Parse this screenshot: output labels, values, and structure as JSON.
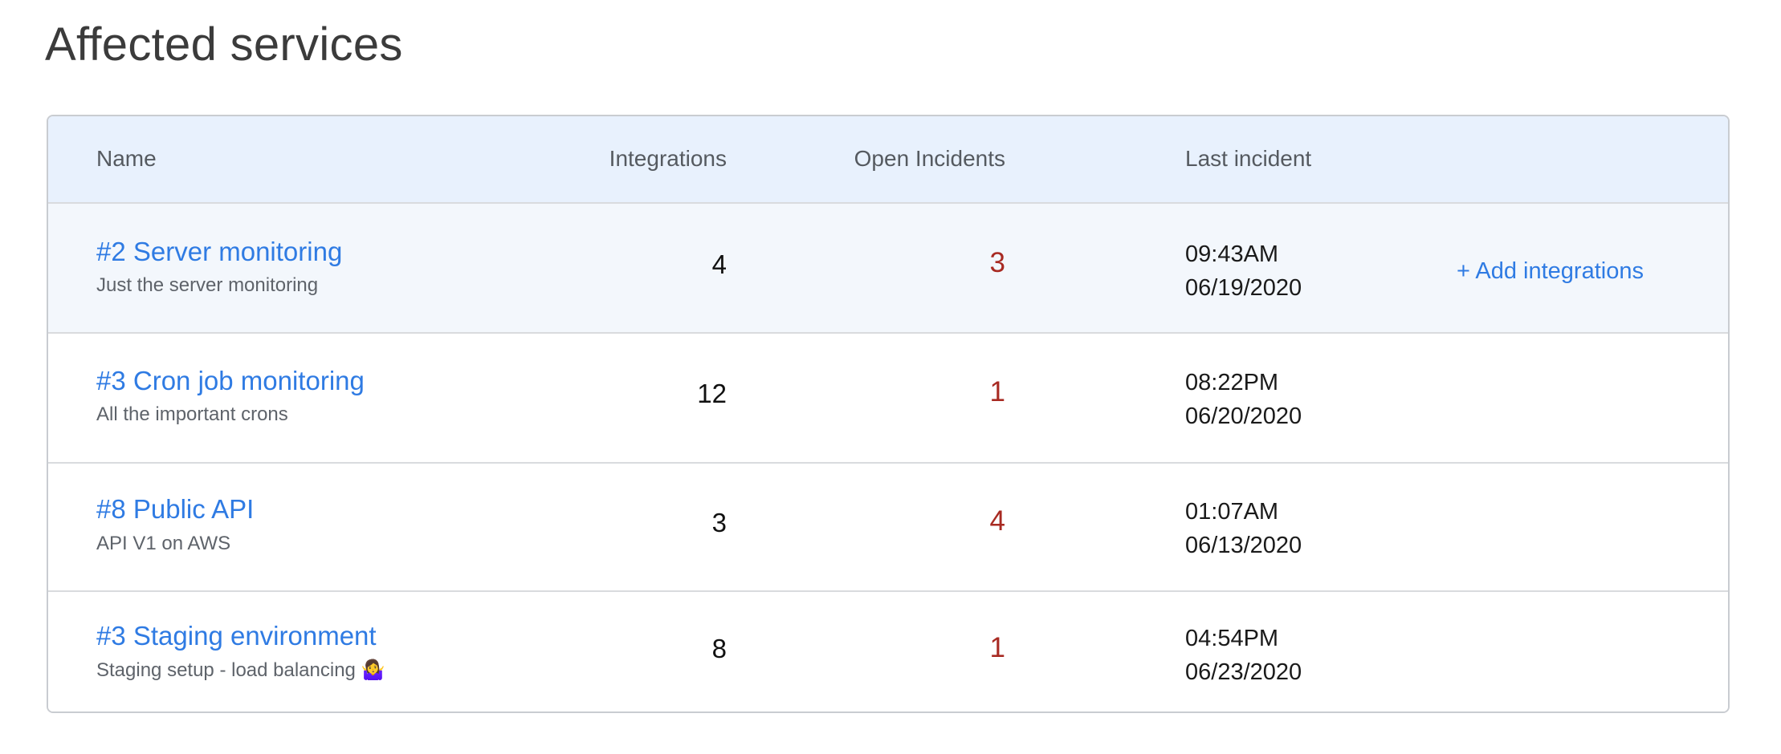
{
  "page": {
    "title": "Affected services"
  },
  "table": {
    "headers": {
      "name": "Name",
      "integrations": "Integrations",
      "open_incidents": "Open Incidents",
      "last_incident": "Last incident"
    },
    "rows": [
      {
        "name": "#2 Server monitoring",
        "description": "Just the server monitoring",
        "integrations": "4",
        "open_incidents": "3",
        "last_time": "09:43AM",
        "last_date": "06/19/2020",
        "action": "+ Add integrations",
        "highlighted": true
      },
      {
        "name": "#3 Cron job monitoring",
        "description": "All the important crons",
        "integrations": "12",
        "open_incidents": "1",
        "last_time": "08:22PM",
        "last_date": "06/20/2020"
      },
      {
        "name": "#8 Public API",
        "description": "API V1 on AWS",
        "integrations": "3",
        "open_incidents": "4",
        "last_time": "01:07AM",
        "last_date": "06/13/2020"
      },
      {
        "name": "#3 Staging environment",
        "description": "Staging setup - load balancing 🤷‍♀️",
        "integrations": "8",
        "open_incidents": "1",
        "last_time": "04:54PM",
        "last_date": "06/23/2020"
      }
    ]
  },
  "colors": {
    "link": "#2f7be3",
    "open_incidents": "#a82a22",
    "header_background": "#e8f1fd",
    "highlight_row_background": "#f3f7fc"
  }
}
